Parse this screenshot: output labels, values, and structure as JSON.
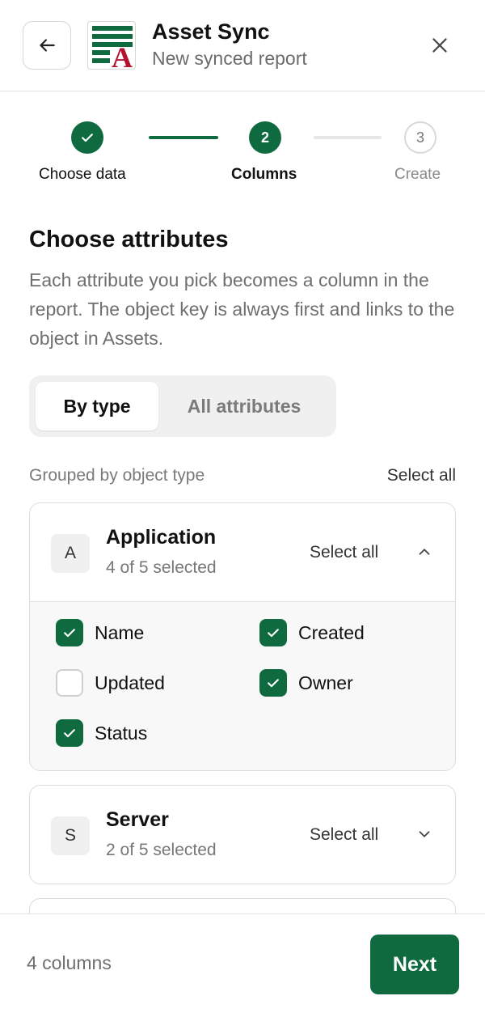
{
  "header": {
    "title": "Asset Sync",
    "subtitle": "New synced report",
    "back_icon": "arrow-left-icon",
    "close_icon": "close-icon",
    "logo_letter": "A"
  },
  "stepper": {
    "steps": [
      {
        "label": "Choose data",
        "state": "complete"
      },
      {
        "number": "2",
        "label": "Columns",
        "state": "active"
      },
      {
        "number": "3",
        "label": "Create",
        "state": "pending"
      }
    ]
  },
  "intro": {
    "title": "Choose attributes",
    "description": "Each attribute you pick becomes a column in the report. The object key is always first and links to the object in Assets."
  },
  "view_toggle": {
    "options": [
      "By type",
      "All attributes"
    ],
    "selected": "By type"
  },
  "list": {
    "caption": "Grouped by object type",
    "select_all_label": "Select all"
  },
  "groups": [
    {
      "badge": "A",
      "name": "Application",
      "summary": "4 of 5 selected",
      "select_all_label": "Select all",
      "expanded": true,
      "attributes": [
        {
          "label": "Name",
          "checked": true
        },
        {
          "label": "Created",
          "checked": true
        },
        {
          "label": "Updated",
          "checked": false
        },
        {
          "label": "Owner",
          "checked": true
        },
        {
          "label": "Status",
          "checked": true
        }
      ]
    },
    {
      "badge": "S",
      "name": "Server",
      "summary": "2 of 5 selected",
      "select_all_label": "Select all",
      "expanded": false
    }
  ],
  "footer": {
    "column_count": "4 columns",
    "next_label": "Next"
  },
  "colors": {
    "accent": "#0f6b3f",
    "logo_red": "#b3132f"
  }
}
